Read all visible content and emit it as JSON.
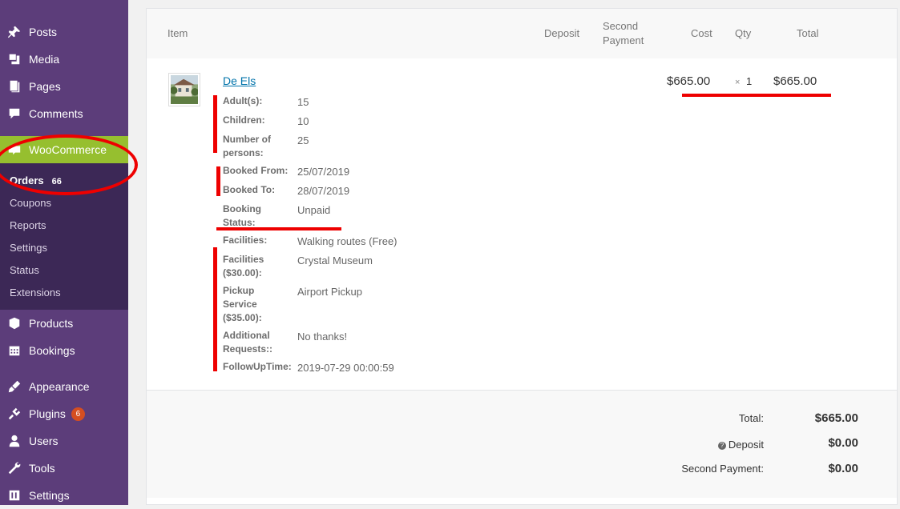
{
  "sidebar": {
    "items": [
      {
        "label": "Posts",
        "icon": "pushpin-icon"
      },
      {
        "label": "Media",
        "icon": "media-icon"
      },
      {
        "label": "Pages",
        "icon": "pages-icon"
      },
      {
        "label": "Comments",
        "icon": "comment-icon"
      },
      {
        "label": "WooCommerce",
        "icon": "woo-icon"
      },
      {
        "label": "Products",
        "icon": "box-icon"
      },
      {
        "label": "Bookings",
        "icon": "calendar-icon"
      },
      {
        "label": "Appearance",
        "icon": "brush-icon"
      },
      {
        "label": "Plugins",
        "icon": "plugin-icon",
        "badge": "6"
      },
      {
        "label": "Users",
        "icon": "user-icon"
      },
      {
        "label": "Tools",
        "icon": "wrench-icon"
      },
      {
        "label": "Settings",
        "icon": "settings-icon"
      }
    ],
    "woo_sub": [
      {
        "label": "Orders",
        "count": "66"
      },
      {
        "label": "Coupons"
      },
      {
        "label": "Reports"
      },
      {
        "label": "Settings"
      },
      {
        "label": "Status"
      },
      {
        "label": "Extensions"
      }
    ]
  },
  "table": {
    "headers": {
      "item": "Item",
      "deposit": "Deposit",
      "second_payment_1": "Second",
      "second_payment_2": "Payment",
      "cost": "Cost",
      "qty": "Qty",
      "total": "Total"
    }
  },
  "order_item": {
    "name": "De Els",
    "cost": "$665.00",
    "qty_symbol": "×",
    "qty": "1",
    "total": "$665.00",
    "meta": [
      {
        "k1": "Adult(s):",
        "v": "15"
      },
      {
        "k1": "Children:",
        "v": "10"
      },
      {
        "k1": "Number of",
        "k2": "persons:",
        "v": "25"
      },
      {
        "k1": "Booked From:",
        "v": "25/07/2019"
      },
      {
        "k1": "Booked To:",
        "v": "28/07/2019"
      },
      {
        "k1": "Booking",
        "k2": "Status:",
        "v": "Unpaid"
      },
      {
        "k1": "Facilities:",
        "v": "Walking routes (Free)"
      },
      {
        "k1": "Facilities",
        "k2": "($30.00):",
        "v": "Crystal Museum"
      },
      {
        "k1": "Pickup",
        "k2": "Service",
        "k3": "($35.00):",
        "v": "Airport Pickup"
      },
      {
        "k1": "Additional",
        "k2": "Requests::",
        "v": "No thanks!"
      },
      {
        "k1": "FollowUpTime:",
        "v": "2019-07-29 00:00:59"
      }
    ]
  },
  "totals": {
    "total_label": "Total:",
    "total_value": "$665.00",
    "deposit_help": "?",
    "deposit_label": "Deposit",
    "deposit_value": "$0.00",
    "second_label": "Second Payment:",
    "second_value": "$0.00"
  },
  "colors": {
    "sidebar_bg": "#5c3d7a",
    "woo_active": "#96bf2f",
    "submenu_bg": "#3c2856",
    "annotation_red": "#e00000",
    "link": "#0073aa"
  }
}
